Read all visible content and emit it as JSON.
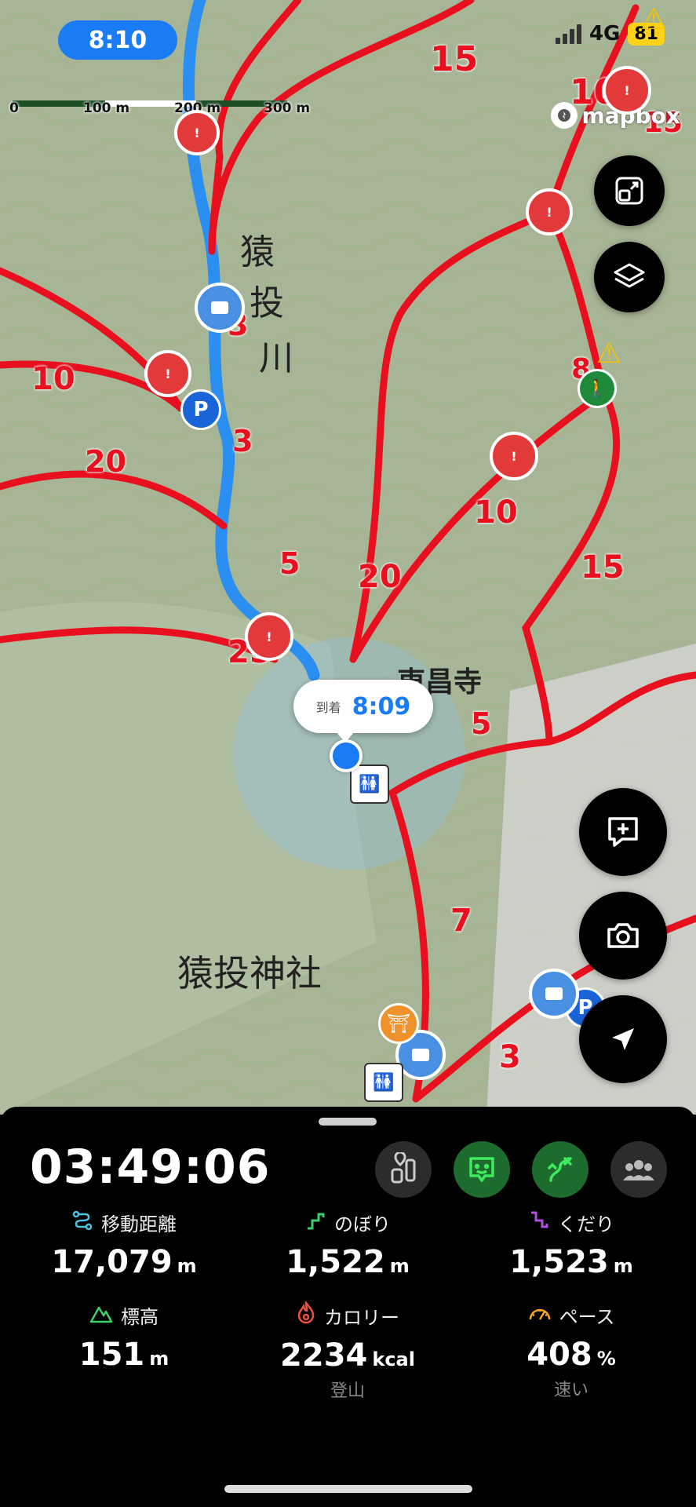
{
  "status_bar": {
    "time": "8:10",
    "network": "4G",
    "battery": "81"
  },
  "map": {
    "scale_labels": [
      "0",
      "100 m",
      "200 m",
      "300 m"
    ],
    "attribution": "mapbox",
    "place_names": [
      "猿",
      "投",
      "川",
      "東昌寺",
      "猿投神社"
    ],
    "trail_minutes": [
      "15",
      "10",
      "15",
      "8",
      "3",
      "10",
      "3",
      "20",
      "10",
      "15",
      "5",
      "20",
      "25",
      "5",
      "7",
      "3"
    ],
    "arrival_callout": {
      "label": "到着",
      "time": "8:09"
    },
    "accent_route": "#2a8ff0",
    "trail_color": "#e8101e"
  },
  "map_controls": [
    "expand-icon",
    "layers-icon",
    "add-note-icon",
    "camera-icon",
    "locate-icon"
  ],
  "panel": {
    "elapsed": "03:49:06",
    "icon_buttons": [
      "trail-marker-icon",
      "chat-bot-icon",
      "route-icon",
      "group-icon"
    ],
    "stats": [
      {
        "label": "移動距離",
        "value": "17,079",
        "unit": "m",
        "icon": "distance-icon",
        "color": "#4fc3e0"
      },
      {
        "label": "のぼり",
        "value": "1,522",
        "unit": "m",
        "icon": "ascent-icon",
        "color": "#3ecf6a"
      },
      {
        "label": "くだり",
        "value": "1,523",
        "unit": "m",
        "icon": "descent-icon",
        "color": "#b34fe0"
      },
      {
        "label": "標高",
        "value": "151",
        "unit": "m",
        "icon": "mountain-icon",
        "color": "#3ecf6a"
      },
      {
        "label": "カロリー",
        "value": "2234",
        "unit": "kcal",
        "icon": "flame-icon",
        "color": "#f0503c",
        "sub": "登山"
      },
      {
        "label": "ペース",
        "value": "408",
        "unit": "%",
        "icon": "gauge-icon",
        "color": "#f5a623",
        "sub": "速い"
      }
    ]
  }
}
